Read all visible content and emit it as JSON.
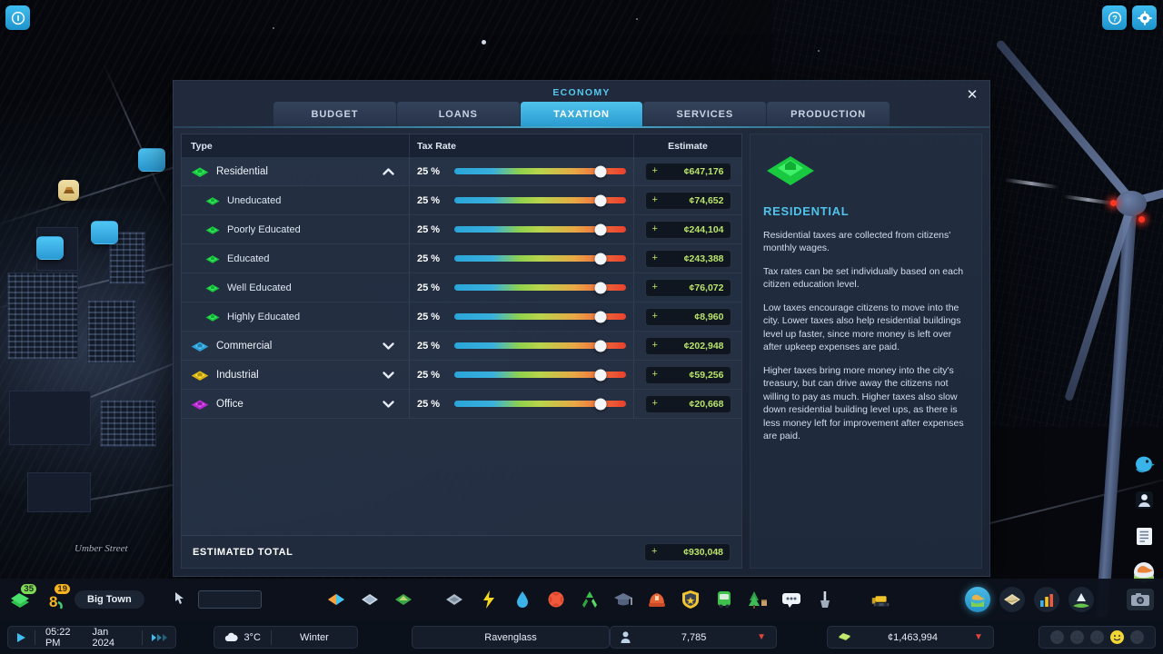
{
  "window": {
    "info_button": "info-icon",
    "help_button": "help-icon",
    "settings_button": "settings-icon"
  },
  "scene": {
    "street_label": "Umber Street"
  },
  "panel": {
    "title": "ECONOMY",
    "close_label": "✕",
    "tabs": [
      {
        "label": "BUDGET",
        "active": false
      },
      {
        "label": "LOANS",
        "active": false
      },
      {
        "label": "TAXATION",
        "active": true
      },
      {
        "label": "SERVICES",
        "active": false
      },
      {
        "label": "PRODUCTION",
        "active": false
      }
    ],
    "columns": {
      "type": "Type",
      "rate": "Tax Rate",
      "estimate": "Estimate"
    },
    "rows": [
      {
        "label": "Residential",
        "zone": "residential",
        "sub": false,
        "chevron": "up",
        "rate": "25 %",
        "rate_pct": 85,
        "estimate": "¢647,176",
        "sign": "+"
      },
      {
        "label": "Uneducated",
        "zone": "residential",
        "sub": true,
        "chevron": "",
        "rate": "25 %",
        "rate_pct": 85,
        "estimate": "¢74,652",
        "sign": "+"
      },
      {
        "label": "Poorly Educated",
        "zone": "residential",
        "sub": true,
        "chevron": "",
        "rate": "25 %",
        "rate_pct": 85,
        "estimate": "¢244,104",
        "sign": "+"
      },
      {
        "label": "Educated",
        "zone": "residential",
        "sub": true,
        "chevron": "",
        "rate": "25 %",
        "rate_pct": 85,
        "estimate": "¢243,388",
        "sign": "+"
      },
      {
        "label": "Well Educated",
        "zone": "residential",
        "sub": true,
        "chevron": "",
        "rate": "25 %",
        "rate_pct": 85,
        "estimate": "¢76,072",
        "sign": "+"
      },
      {
        "label": "Highly Educated",
        "zone": "residential",
        "sub": true,
        "chevron": "",
        "rate": "25 %",
        "rate_pct": 85,
        "estimate": "¢8,960",
        "sign": "+"
      },
      {
        "label": "Commercial",
        "zone": "commercial",
        "sub": false,
        "chevron": "down",
        "rate": "25 %",
        "rate_pct": 85,
        "estimate": "¢202,948",
        "sign": "+"
      },
      {
        "label": "Industrial",
        "zone": "industrial",
        "sub": false,
        "chevron": "down",
        "rate": "25 %",
        "rate_pct": 85,
        "estimate": "¢59,256",
        "sign": "+"
      },
      {
        "label": "Office",
        "zone": "office",
        "sub": false,
        "chevron": "down",
        "rate": "25 %",
        "rate_pct": 85,
        "estimate": "¢20,668",
        "sign": "+"
      }
    ],
    "total": {
      "label": "ESTIMATED TOTAL",
      "sign": "+",
      "value": "¢930,048"
    },
    "info": {
      "icon": "residential-zone-icon",
      "title": "RESIDENTIAL",
      "paragraphs": [
        "Residential taxes are collected from citizens' monthly wages.",
        "Tax rates can be set individually based on each citizen education level.",
        "Low taxes encourage citizens to move into the city. Lower taxes also help residential buildings level up faster, since more money is left over after upkeep expenses are paid.",
        "Higher taxes bring more money into the city's treasury, but can drive away the citizens not willing to pay as much. Higher taxes also slow down residential building level ups, as there is less money left for improvement after expenses are paid."
      ]
    }
  },
  "toolbar": {
    "xp_badge": "35",
    "milestone_badge": "19",
    "city_name": "Big Town",
    "tools": [
      "zones-icon",
      "roads-icon",
      "terrain-icon",
      "roads-alt-icon",
      "electricity-icon",
      "water-icon",
      "healthcare-icon",
      "garbage-icon",
      "education-icon",
      "fire-icon",
      "police-icon",
      "transportation-icon",
      "parks-icon",
      "communications-icon",
      "landscaping-icon",
      "bulldoze-icon"
    ],
    "right_tools": [
      "economy-icon",
      "map-icon",
      "statistics-icon",
      "progression-icon",
      "photo-mode-icon"
    ]
  },
  "statusbar": {
    "play_icon": "play-icon",
    "time": "05:22 PM",
    "date": "Jan 2024",
    "fastforward_icon": "fast-forward-icon",
    "weather_icon": "cloud-icon",
    "temperature": "3°C",
    "season": "Winter",
    "city": "Ravenglass",
    "population_icon": "population-icon",
    "population": "7,785",
    "population_trend": "▼",
    "money_icon": "money-icon",
    "money": "¢1,463,994",
    "money_trend": "▼",
    "happiness_active_index": 3
  },
  "side_icons": [
    "chirper-icon",
    "citizen-info-icon",
    "notifications-icon",
    "radio-icon"
  ],
  "colors": {
    "accent": "#4fc3ec",
    "money_green": "#b9e36a",
    "residential": "#2ee05a",
    "commercial": "#36b6ea",
    "industrial": "#f2d019",
    "office": "#d43ce8",
    "negative": "#e0453a"
  }
}
